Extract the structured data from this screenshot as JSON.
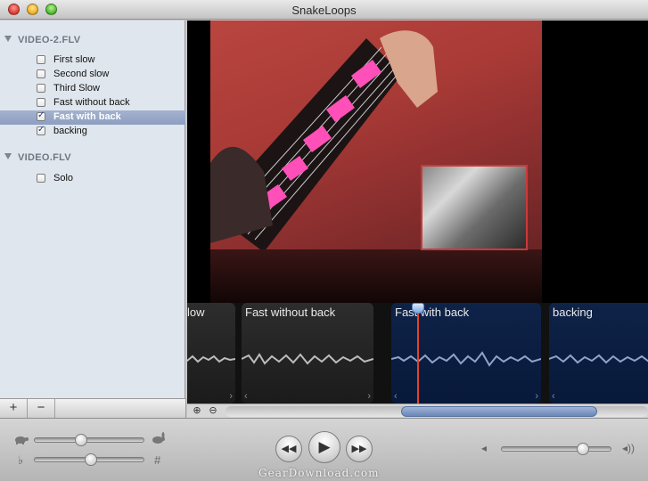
{
  "window": {
    "title": "SnakeLoops"
  },
  "sidebar": {
    "groups": [
      {
        "name": "VIDEO-2.FLV",
        "items": [
          {
            "label": "First slow",
            "checked": false,
            "selected": false
          },
          {
            "label": "Second slow",
            "checked": false,
            "selected": false
          },
          {
            "label": "Third Slow",
            "checked": false,
            "selected": false
          },
          {
            "label": "Fast without back",
            "checked": false,
            "selected": false
          },
          {
            "label": "Fast with back",
            "checked": true,
            "selected": true
          },
          {
            "label": "backing",
            "checked": true,
            "selected": false
          }
        ]
      },
      {
        "name": "VIDEO.FLV",
        "items": [
          {
            "label": "Solo",
            "checked": false,
            "selected": false
          }
        ]
      }
    ],
    "footer": {
      "add_label": "+",
      "remove_label": "−"
    }
  },
  "timeline": {
    "clips": [
      {
        "label": "low",
        "selected": false
      },
      {
        "label": "Fast without back",
        "selected": false
      },
      {
        "label": "Fast with back",
        "selected": true
      },
      {
        "label": "backing",
        "selected": true
      }
    ],
    "chevron_left": "‹",
    "chevron_right": "›"
  },
  "zoom": {
    "in_label": "⊕",
    "out_label": "⊖"
  },
  "controls": {
    "speed_slow_icon": "turtle-icon",
    "speed_fast_icon": "hare-icon",
    "pitch_flat_label": "♭",
    "pitch_sharp_label": "#",
    "rewind_label": "◀◀",
    "play_label": "▶",
    "forward_label": "▶▶",
    "volume_low_label": "◂",
    "volume_high_label": "◂))",
    "speed_value": 0.5,
    "pitch_value": 0.5,
    "volume_value": 0.72
  },
  "watermark": "GearDownload.com",
  "colors": {
    "selection": "#8d9ec0",
    "playhead": "#e0452a",
    "clip_selected": "#0e2348"
  }
}
